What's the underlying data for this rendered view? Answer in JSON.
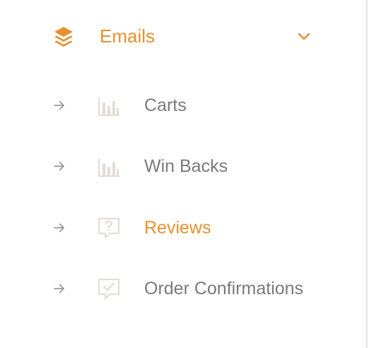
{
  "colors": {
    "accent": "#e8902e",
    "text_muted": "#7a7a7a",
    "icon_muted": "#e3ddd6",
    "arrow": "#8a8a8a"
  },
  "section": {
    "icon": "layers-icon",
    "label": "Emails",
    "expanded": true,
    "chevron_icon": "chevron-down-icon"
  },
  "items": [
    {
      "label": "Carts",
      "icon": "bar-chart-icon",
      "arrow_icon": "arrow-right-icon",
      "active": false
    },
    {
      "label": "Win Backs",
      "icon": "bar-chart-icon",
      "arrow_icon": "arrow-right-icon",
      "active": false
    },
    {
      "label": "Reviews",
      "icon": "question-chat-icon",
      "arrow_icon": "arrow-right-icon",
      "active": true
    },
    {
      "label": "Order Confirmations",
      "icon": "check-chat-icon",
      "arrow_icon": "arrow-right-icon",
      "active": false
    }
  ]
}
